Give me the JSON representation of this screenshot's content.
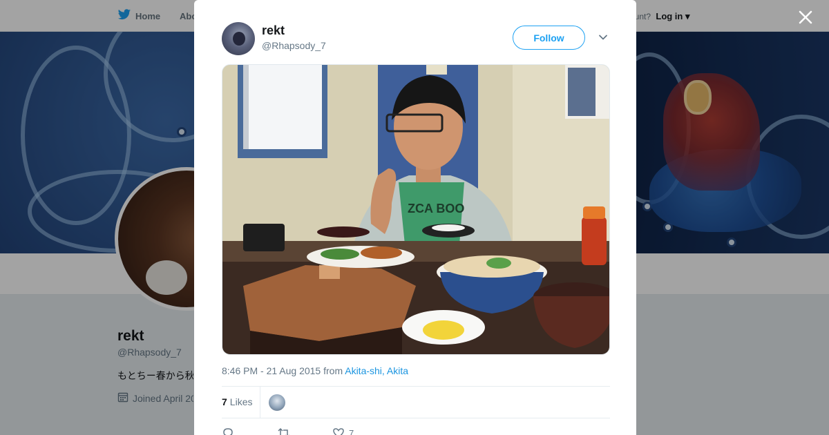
{
  "topnav": {
    "home_label": "Home",
    "about_label": "Abo",
    "account_prompt": "ccount?",
    "login_label": "Log in"
  },
  "profile": {
    "name": "rekt",
    "handle": "@Rhapsody_7",
    "bio": "もとちー春から秋",
    "joined": "Joined April 20"
  },
  "tweet": {
    "author_name": "rekt",
    "author_handle": "@Rhapsody_7",
    "follow_label": "Follow",
    "time": "8:46 PM - 21 Aug 2015",
    "from_word": "from",
    "location": "Akita-shi, Akita",
    "likes_count": "7",
    "likes_label": "Likes",
    "action_like_count": "7"
  },
  "colors": {
    "accent": "#1da1f2",
    "link": "#1b95e0",
    "muted": "#657786"
  },
  "icons": [
    "twitter-bird-icon",
    "close-icon",
    "chevron-down-icon",
    "reply-icon",
    "retweet-icon",
    "heart-icon",
    "calendar-icon"
  ]
}
